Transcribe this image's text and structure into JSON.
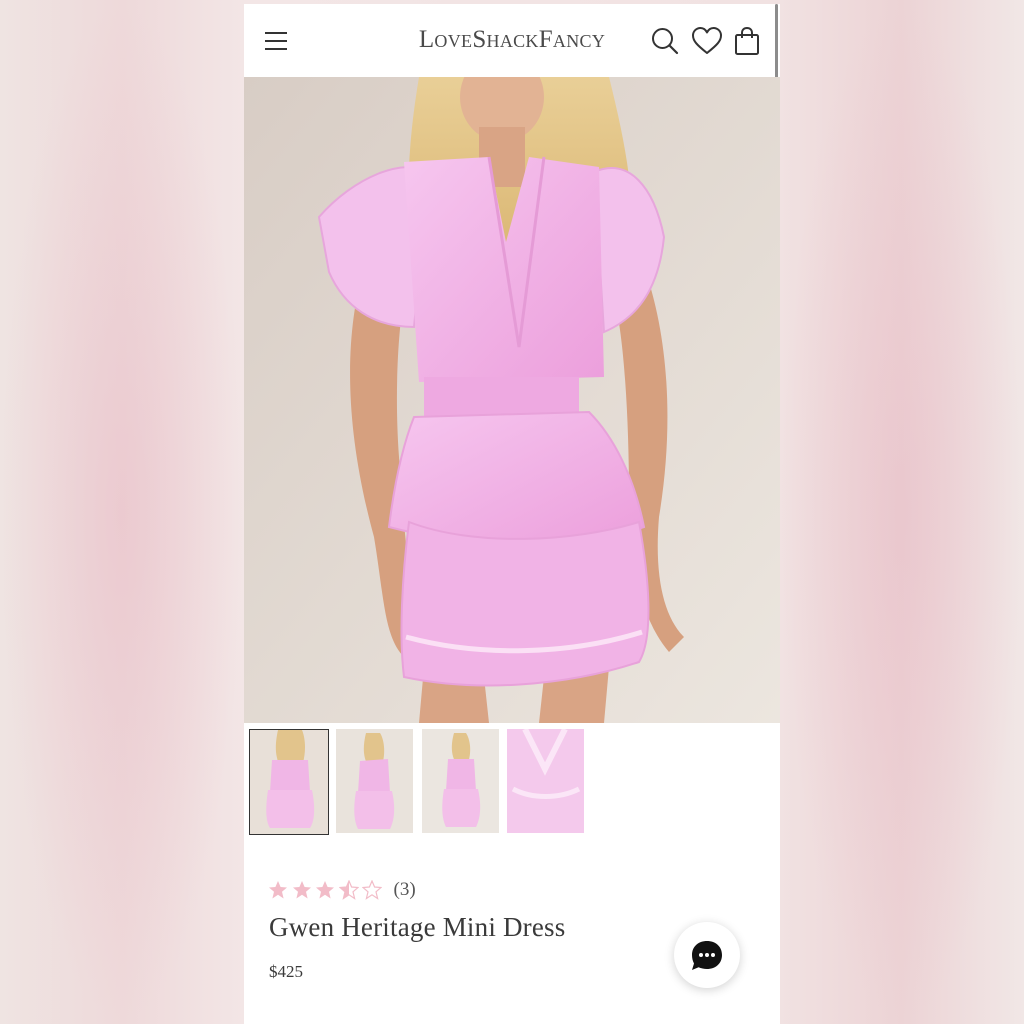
{
  "header": {
    "brand": "LoveShackFancy",
    "icons": [
      "menu-icon",
      "search-icon",
      "heart-icon",
      "shopping-bag-icon"
    ]
  },
  "gallery": {
    "thumbnail_count": 4,
    "active_index": 0
  },
  "product": {
    "rating": 3.5,
    "rating_max": 5,
    "review_count": "(3)",
    "name": "Gwen Heritage Mini Dress",
    "price": "$425"
  },
  "chat": {
    "icon": "chat-bubble-icon"
  },
  "colors": {
    "dress_pink": "#efb0e4",
    "star_pink": "#f2bcc8",
    "text_dark": "#3a3a3a"
  }
}
